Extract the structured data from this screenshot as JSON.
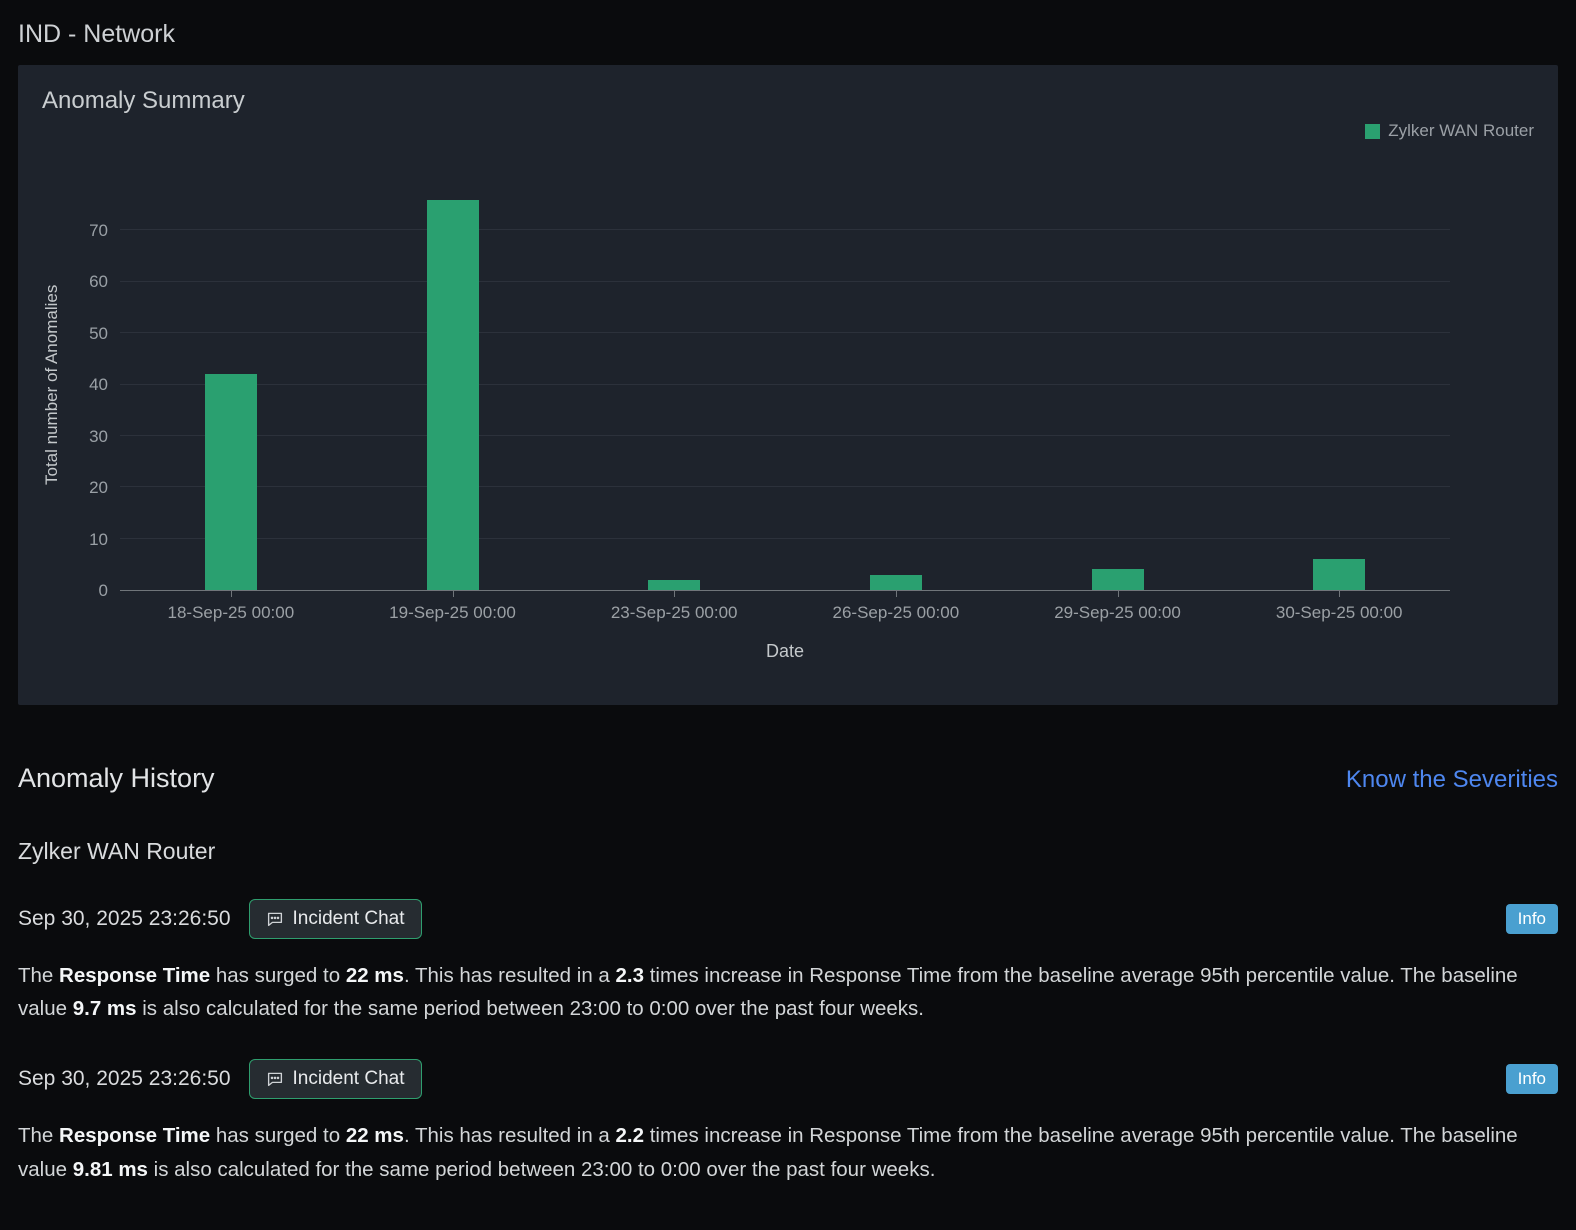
{
  "page": {
    "title": "IND - Network"
  },
  "summary": {
    "title": "Anomaly Summary",
    "legend": {
      "label": "Zylker WAN Router",
      "color": "#2aa070"
    }
  },
  "chart_data": {
    "type": "bar",
    "title": "Anomaly Summary",
    "categories": [
      "18-Sep-25 00:00",
      "19-Sep-25 00:00",
      "23-Sep-25 00:00",
      "26-Sep-25 00:00",
      "29-Sep-25 00:00",
      "30-Sep-25 00:00"
    ],
    "series": [
      {
        "name": "Zylker WAN Router",
        "values": [
          42,
          76,
          2,
          3,
          4,
          6
        ]
      }
    ],
    "xlabel": "Date",
    "ylabel": "Total number of Anomalies",
    "ylim": [
      0,
      80
    ],
    "yticks": [
      0,
      10,
      20,
      30,
      40,
      50,
      60,
      70
    ],
    "grid": true,
    "legend_position": "top-right",
    "bar_color": "#2aa070"
  },
  "history": {
    "title": "Anomaly History",
    "link_label": "Know the Severities",
    "device": "Zylker WAN Router",
    "entries": [
      {
        "timestamp": "Sep 30, 2025 23:26:50",
        "chat_button_label": "Incident Chat",
        "badge": "Info",
        "segments": [
          {
            "t": "The ",
            "b": false
          },
          {
            "t": "Response Time",
            "b": true
          },
          {
            "t": " has surged to ",
            "b": false
          },
          {
            "t": "22 ms",
            "b": true
          },
          {
            "t": ". This has resulted in a ",
            "b": false
          },
          {
            "t": "2.3",
            "b": true
          },
          {
            "t": " times increase in Response Time from the baseline average 95th percentile value. The baseline value ",
            "b": false
          },
          {
            "t": "9.7 ms",
            "b": true
          },
          {
            "t": " is also calculated for the same period between 23:00 to 0:00 over the past four weeks.",
            "b": false
          }
        ]
      },
      {
        "timestamp": "Sep 30, 2025 23:26:50",
        "chat_button_label": "Incident Chat",
        "badge": "Info",
        "segments": [
          {
            "t": "The ",
            "b": false
          },
          {
            "t": "Response Time",
            "b": true
          },
          {
            "t": " has surged to ",
            "b": false
          },
          {
            "t": "22 ms",
            "b": true
          },
          {
            "t": ". This has resulted in a ",
            "b": false
          },
          {
            "t": "2.2",
            "b": true
          },
          {
            "t": " times increase in Response Time from the baseline average 95th percentile value. The baseline value ",
            "b": false
          },
          {
            "t": "9.81 ms",
            "b": true
          },
          {
            "t": " is also calculated for the same period between 23:00 to 0:00 over the past four weeks.",
            "b": false
          }
        ]
      }
    ]
  },
  "colors": {
    "bar": "#2aa070",
    "link": "#4e87f0",
    "badge_bg": "#4aa0d0",
    "chat_border": "#2f9e6e"
  }
}
